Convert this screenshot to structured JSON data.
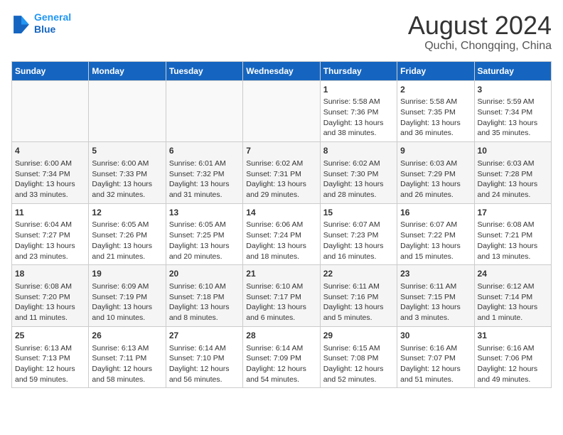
{
  "header": {
    "logo": {
      "line1": "General",
      "line2": "Blue"
    },
    "title": "August 2024",
    "subtitle": "Quchi, Chongqing, China"
  },
  "calendar": {
    "headers": [
      "Sunday",
      "Monday",
      "Tuesday",
      "Wednesday",
      "Thursday",
      "Friday",
      "Saturday"
    ],
    "weeks": [
      {
        "rowClass": "row-odd",
        "days": [
          {
            "num": "",
            "info": "",
            "empty": true
          },
          {
            "num": "",
            "info": "",
            "empty": true
          },
          {
            "num": "",
            "info": "",
            "empty": true
          },
          {
            "num": "",
            "info": "",
            "empty": true
          },
          {
            "num": "1",
            "info": "Sunrise: 5:58 AM\nSunset: 7:36 PM\nDaylight: 13 hours\nand 38 minutes."
          },
          {
            "num": "2",
            "info": "Sunrise: 5:58 AM\nSunset: 7:35 PM\nDaylight: 13 hours\nand 36 minutes."
          },
          {
            "num": "3",
            "info": "Sunrise: 5:59 AM\nSunset: 7:34 PM\nDaylight: 13 hours\nand 35 minutes."
          }
        ]
      },
      {
        "rowClass": "row-even",
        "days": [
          {
            "num": "4",
            "info": "Sunrise: 6:00 AM\nSunset: 7:34 PM\nDaylight: 13 hours\nand 33 minutes."
          },
          {
            "num": "5",
            "info": "Sunrise: 6:00 AM\nSunset: 7:33 PM\nDaylight: 13 hours\nand 32 minutes."
          },
          {
            "num": "6",
            "info": "Sunrise: 6:01 AM\nSunset: 7:32 PM\nDaylight: 13 hours\nand 31 minutes."
          },
          {
            "num": "7",
            "info": "Sunrise: 6:02 AM\nSunset: 7:31 PM\nDaylight: 13 hours\nand 29 minutes."
          },
          {
            "num": "8",
            "info": "Sunrise: 6:02 AM\nSunset: 7:30 PM\nDaylight: 13 hours\nand 28 minutes."
          },
          {
            "num": "9",
            "info": "Sunrise: 6:03 AM\nSunset: 7:29 PM\nDaylight: 13 hours\nand 26 minutes."
          },
          {
            "num": "10",
            "info": "Sunrise: 6:03 AM\nSunset: 7:28 PM\nDaylight: 13 hours\nand 24 minutes."
          }
        ]
      },
      {
        "rowClass": "row-odd",
        "days": [
          {
            "num": "11",
            "info": "Sunrise: 6:04 AM\nSunset: 7:27 PM\nDaylight: 13 hours\nand 23 minutes."
          },
          {
            "num": "12",
            "info": "Sunrise: 6:05 AM\nSunset: 7:26 PM\nDaylight: 13 hours\nand 21 minutes."
          },
          {
            "num": "13",
            "info": "Sunrise: 6:05 AM\nSunset: 7:25 PM\nDaylight: 13 hours\nand 20 minutes."
          },
          {
            "num": "14",
            "info": "Sunrise: 6:06 AM\nSunset: 7:24 PM\nDaylight: 13 hours\nand 18 minutes."
          },
          {
            "num": "15",
            "info": "Sunrise: 6:07 AM\nSunset: 7:23 PM\nDaylight: 13 hours\nand 16 minutes."
          },
          {
            "num": "16",
            "info": "Sunrise: 6:07 AM\nSunset: 7:22 PM\nDaylight: 13 hours\nand 15 minutes."
          },
          {
            "num": "17",
            "info": "Sunrise: 6:08 AM\nSunset: 7:21 PM\nDaylight: 13 hours\nand 13 minutes."
          }
        ]
      },
      {
        "rowClass": "row-even",
        "days": [
          {
            "num": "18",
            "info": "Sunrise: 6:08 AM\nSunset: 7:20 PM\nDaylight: 13 hours\nand 11 minutes."
          },
          {
            "num": "19",
            "info": "Sunrise: 6:09 AM\nSunset: 7:19 PM\nDaylight: 13 hours\nand 10 minutes."
          },
          {
            "num": "20",
            "info": "Sunrise: 6:10 AM\nSunset: 7:18 PM\nDaylight: 13 hours\nand 8 minutes."
          },
          {
            "num": "21",
            "info": "Sunrise: 6:10 AM\nSunset: 7:17 PM\nDaylight: 13 hours\nand 6 minutes."
          },
          {
            "num": "22",
            "info": "Sunrise: 6:11 AM\nSunset: 7:16 PM\nDaylight: 13 hours\nand 5 minutes."
          },
          {
            "num": "23",
            "info": "Sunrise: 6:11 AM\nSunset: 7:15 PM\nDaylight: 13 hours\nand 3 minutes."
          },
          {
            "num": "24",
            "info": "Sunrise: 6:12 AM\nSunset: 7:14 PM\nDaylight: 13 hours\nand 1 minute."
          }
        ]
      },
      {
        "rowClass": "row-odd",
        "days": [
          {
            "num": "25",
            "info": "Sunrise: 6:13 AM\nSunset: 7:13 PM\nDaylight: 12 hours\nand 59 minutes."
          },
          {
            "num": "26",
            "info": "Sunrise: 6:13 AM\nSunset: 7:11 PM\nDaylight: 12 hours\nand 58 minutes."
          },
          {
            "num": "27",
            "info": "Sunrise: 6:14 AM\nSunset: 7:10 PM\nDaylight: 12 hours\nand 56 minutes."
          },
          {
            "num": "28",
            "info": "Sunrise: 6:14 AM\nSunset: 7:09 PM\nDaylight: 12 hours\nand 54 minutes."
          },
          {
            "num": "29",
            "info": "Sunrise: 6:15 AM\nSunset: 7:08 PM\nDaylight: 12 hours\nand 52 minutes."
          },
          {
            "num": "30",
            "info": "Sunrise: 6:16 AM\nSunset: 7:07 PM\nDaylight: 12 hours\nand 51 minutes."
          },
          {
            "num": "31",
            "info": "Sunrise: 6:16 AM\nSunset: 7:06 PM\nDaylight: 12 hours\nand 49 minutes."
          }
        ]
      }
    ]
  }
}
